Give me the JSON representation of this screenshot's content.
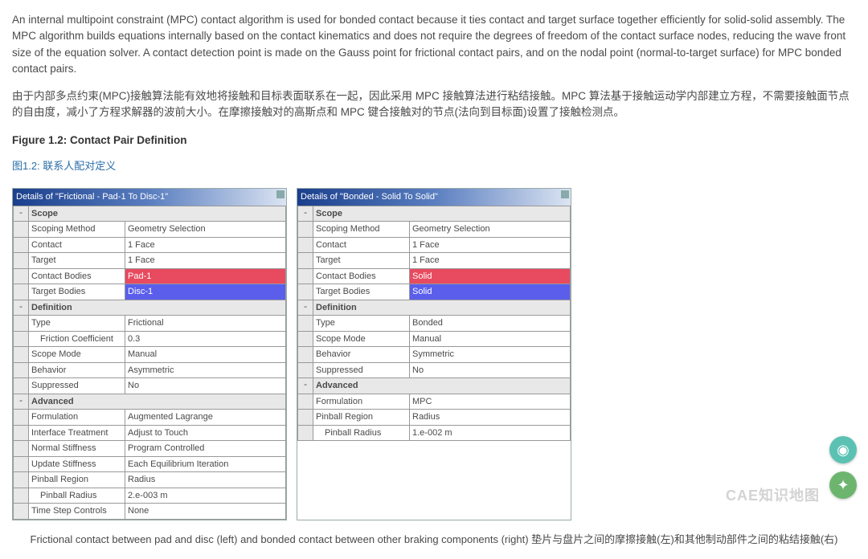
{
  "paragraphs": {
    "p1": "An internal multipoint constraint (MPC) contact algorithm is used for bonded contact because it ties contact and target surface together efficiently for solid-solid assembly. The MPC algorithm builds equations internally based on the contact kinematics and does not require the degrees of freedom of the contact surface nodes, reducing the wave front size of the equation solver. A contact detection point is made on the Gauss point for frictional contact pairs, and on the nodal point (normal-to-target surface) for MPC bonded contact pairs.",
    "p2": "由于内部多点约束(MPC)接触算法能有效地将接触和目标表面联系在一起，因此采用 MPC 接触算法进行粘结接触。MPC 算法基于接触运动学内部建立方程，不需要接触面节点的自由度，减小了方程求解器的波前大小。在摩擦接触对的高斯点和 MPC 键合接触对的节点(法向到目标面)设置了接触检测点。",
    "figtitle": "Figure 1.2: Contact Pair Definition",
    "figcn": "图1.2: 联系人配对定义"
  },
  "left": {
    "title": "Details of \"Frictional - Pad-1 To Disc-1\"",
    "scope": {
      "hdr": "Scope",
      "method_l": "Scoping Method",
      "method_v": "Geometry Selection",
      "contact_l": "Contact",
      "contact_v": "1 Face",
      "target_l": "Target",
      "target_v": "1 Face",
      "cb_l": "Contact Bodies",
      "cb_v": "Pad-1",
      "tb_l": "Target Bodies",
      "tb_v": "Disc-1"
    },
    "def": {
      "hdr": "Definition",
      "type_l": "Type",
      "type_v": "Frictional",
      "fc_l": "Friction Coefficient",
      "fc_v": "0.3",
      "sm_l": "Scope Mode",
      "sm_v": "Manual",
      "beh_l": "Behavior",
      "beh_v": "Asymmetric",
      "sup_l": "Suppressed",
      "sup_v": "No"
    },
    "adv": {
      "hdr": "Advanced",
      "form_l": "Formulation",
      "form_v": "Augmented Lagrange",
      "it_l": "Interface Treatment",
      "it_v": "Adjust to Touch",
      "ns_l": "Normal Stiffness",
      "ns_v": "Program Controlled",
      "us_l": "Update Stiffness",
      "us_v": "Each Equilibrium Iteration",
      "pr_l": "Pinball Region",
      "pr_v": "Radius",
      "prr_l": "Pinball Radius",
      "prr_v": "2.e-003 m",
      "ts_l": "Time Step Controls",
      "ts_v": "None"
    }
  },
  "right": {
    "title": "Details of \"Bonded - Solid To Solid\"",
    "scope": {
      "hdr": "Scope",
      "method_l": "Scoping Method",
      "method_v": "Geometry Selection",
      "contact_l": "Contact",
      "contact_v": "1 Face",
      "target_l": "Target",
      "target_v": "1 Face",
      "cb_l": "Contact Bodies",
      "cb_v": "Solid",
      "tb_l": "Target Bodies",
      "tb_v": "Solid"
    },
    "def": {
      "hdr": "Definition",
      "type_l": "Type",
      "type_v": "Bonded",
      "sm_l": "Scope Mode",
      "sm_v": "Manual",
      "beh_l": "Behavior",
      "beh_v": "Symmetric",
      "sup_l": "Suppressed",
      "sup_v": "No"
    },
    "adv": {
      "hdr": "Advanced",
      "form_l": "Formulation",
      "form_v": "MPC",
      "pr_l": "Pinball Region",
      "pr_v": "Radius",
      "prr_l": "Pinball Radius",
      "prr_v": "1.e-002 m"
    }
  },
  "caption": "Frictional contact between pad and disc (left) and bonded contact between other braking components (right) 垫片与盘片之间的摩擦接触(左)和其他制动部件之间的粘结接触(右)",
  "watermark": "CAE知识地图",
  "icons": {
    "minus": "-",
    "plus": "+",
    "person": "◉",
    "chat": "✦"
  }
}
